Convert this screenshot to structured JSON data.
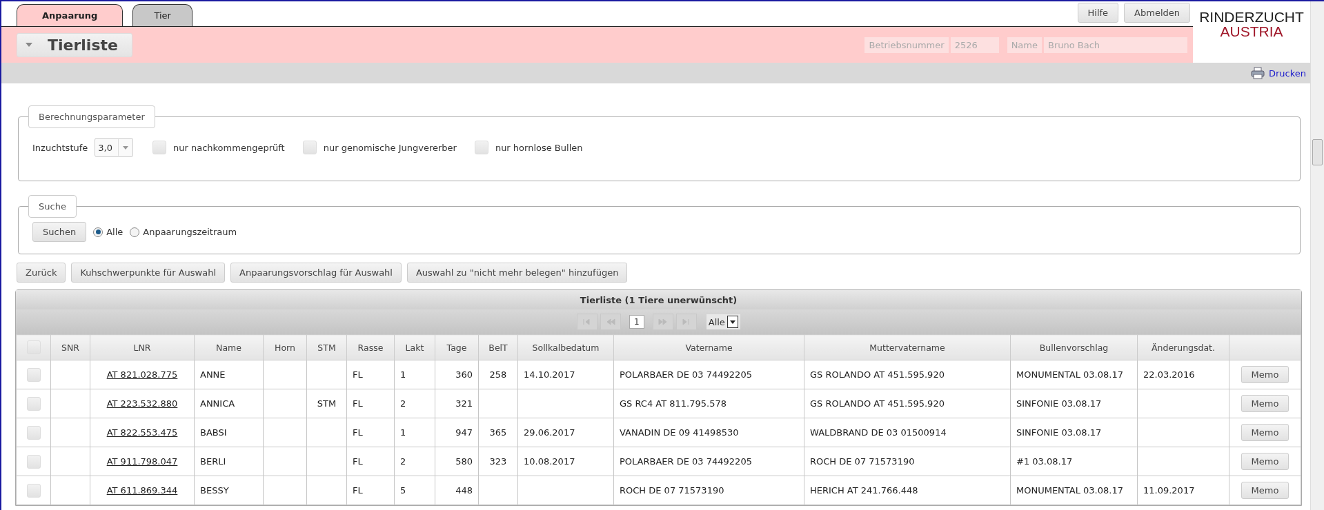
{
  "tabs": [
    {
      "label": "Anpaarung",
      "selected": true
    },
    {
      "label": "Tier",
      "selected": false
    }
  ],
  "header_buttons": [
    "Hilfe",
    "Abmelden"
  ],
  "logo": {
    "line1": "RINDERZUCHT",
    "line2": "AUSTRIA"
  },
  "page_title": "Tierliste",
  "fields": [
    {
      "label": "Betriebsnummer",
      "value": "2526"
    },
    {
      "label": "Name",
      "value": "Bruno Bach"
    }
  ],
  "print_link": "Drucken",
  "parameters": {
    "legend": "Berechnungsparameter",
    "inbreeding_label": "Inzuchtstufe",
    "inbreeding_value": "3,0",
    "checkboxes": [
      {
        "label": "nur nachkommengeprüft",
        "checked": false
      },
      {
        "label": "nur genomische Jungvererber",
        "checked": false
      },
      {
        "label": "nur hornlose Bullen",
        "checked": false
      }
    ]
  },
  "search": {
    "legend": "Suche",
    "button": "Suchen",
    "radios": [
      {
        "label": "Alle",
        "selected": true
      },
      {
        "label": "Anpaarungszeitraum",
        "selected": false
      }
    ]
  },
  "action_buttons": [
    "Zurück",
    "Kuhschwerpunkte für Auswahl",
    "Anpaarungsvorschlag für Auswahl",
    "Auswahl zu \"nicht mehr belegen\" hinzufügen"
  ],
  "table": {
    "select_all_checked": false,
    "title": "Tierliste (1 Tiere unerwünscht)",
    "pager": {
      "page": "1",
      "filter": "Alle"
    },
    "columns": [
      "SNR",
      "LNR",
      "Name",
      "Horn",
      "STM",
      "Rasse",
      "Lakt",
      "Tage",
      "BelT",
      "Sollkalbedatum",
      "Vatername",
      "Muttervatername",
      "Bullenvorschlag",
      "Änderungsdat."
    ],
    "rows": [
      {
        "checked": false,
        "lnr": "AT 821.028.775",
        "name": "ANNE",
        "rasse": "FL",
        "lakt": "1",
        "tage": "360",
        "belt": "258",
        "soll": "14.10.2017",
        "vater": "POLARBAER DE 03 74492205",
        "mutter": "GS ROLANDO AT 451.595.920",
        "bulle": "MONUMENTAL 03.08.17",
        "aend": "22.03.2016",
        "memo": "Memo"
      },
      {
        "checked": false,
        "lnr": "AT 223.532.880",
        "name": "ANNICA",
        "stm": "STM",
        "rasse": "FL",
        "lakt": "2",
        "tage": "321",
        "vater": "GS RC4 AT 811.795.578",
        "mutter": "GS ROLANDO AT 451.595.920",
        "bulle": "SINFONIE 03.08.17",
        "memo": "Memo"
      },
      {
        "checked": false,
        "lnr": "AT 822.553.475",
        "name": "BABSI",
        "rasse": "FL",
        "lakt": "1",
        "tage": "947",
        "belt": "365",
        "soll": "29.06.2017",
        "vater": "VANADIN DE 09 41498530",
        "mutter": "WALDBRAND DE 03 01500914",
        "bulle": "SINFONIE 03.08.17",
        "memo": "Memo"
      },
      {
        "checked": false,
        "lnr": "AT 911.798.047",
        "name": "BERLI",
        "rasse": "FL",
        "lakt": "2",
        "tage": "580",
        "belt": "323",
        "soll": "10.08.2017",
        "vater": "POLARBAER DE 03 74492205",
        "mutter": "ROCH DE 07 71573190",
        "bulle": "#1 03.08.17",
        "memo": "Memo"
      },
      {
        "checked": false,
        "lnr": "AT 611.869.344",
        "name": "BESSY",
        "rasse": "FL",
        "lakt": "5",
        "tage": "448",
        "vater": "ROCH DE 07 71573190",
        "mutter": "HERICH AT 241.766.448",
        "bulle": "MONUMENTAL 03.08.17",
        "aend": "11.09.2017",
        "memo": "Memo"
      }
    ]
  }
}
